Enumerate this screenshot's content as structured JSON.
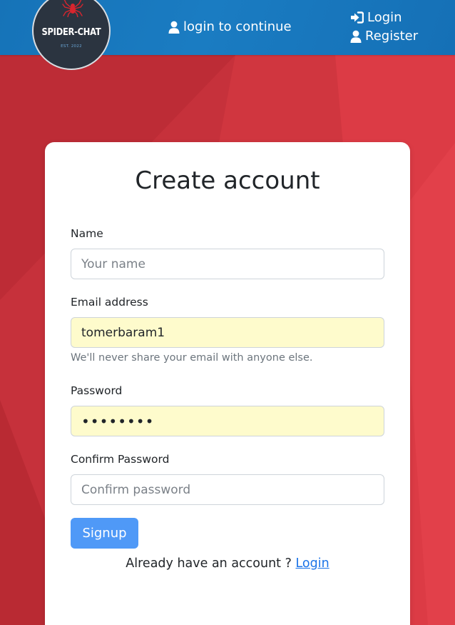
{
  "colors": {
    "header": "#1673b8",
    "background": "#c9333a",
    "button": "#4f99f7",
    "link": "#1a73e8",
    "autofill": "#fefbcc"
  },
  "header": {
    "logo": {
      "name": "SPIDER-CHAT",
      "est": "EST. 2022",
      "icon": "spider-icon"
    },
    "center_text": "login to continue",
    "center_icon": "user-icon",
    "nav": {
      "login": "Login",
      "login_icon": "sign-in-icon",
      "register": "Register",
      "register_icon": "user-icon"
    }
  },
  "form": {
    "title": "Create account",
    "name": {
      "label": "Name",
      "value": "",
      "placeholder": "Your name"
    },
    "email": {
      "label": "Email address",
      "value": "tomerbaram1",
      "placeholder": "",
      "help": "We'll never share your email with anyone else."
    },
    "password": {
      "label": "Password",
      "value": "••••••••"
    },
    "confirm_password": {
      "label": "Confirm Password",
      "value": "",
      "placeholder": "Confirm password"
    },
    "submit_label": "Signup",
    "footer_text": "Already have an account ?",
    "footer_link": "Login"
  }
}
